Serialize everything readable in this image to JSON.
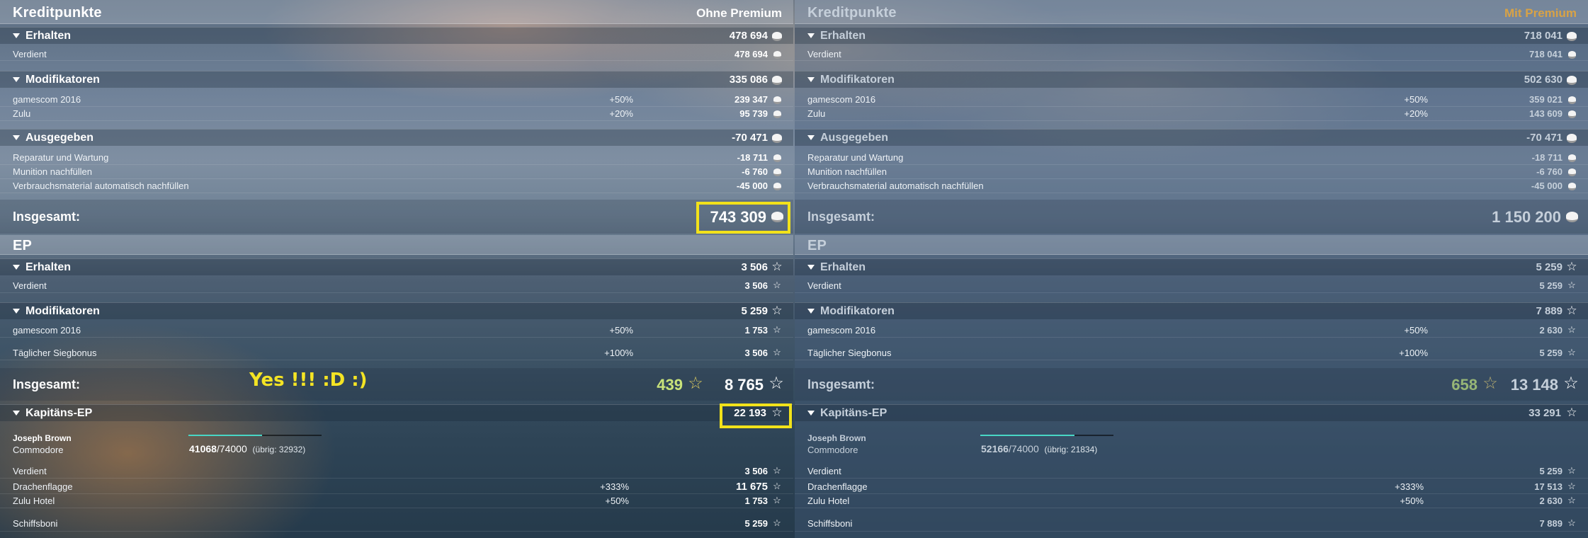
{
  "left": {
    "title": "Kreditpunkte",
    "mode": "Ohne Premium",
    "credits": {
      "earned": {
        "label": "Erhalten",
        "value": "478 694",
        "items": [
          {
            "label": "Verdient",
            "value": "478 694"
          }
        ]
      },
      "modifiers": {
        "label": "Modifikatoren",
        "value": "335 086",
        "items": [
          {
            "label": "gamescom 2016",
            "pct": "+50%",
            "value": "239 347"
          },
          {
            "label": "Zulu",
            "pct": "+20%",
            "value": "95 739"
          }
        ]
      },
      "spent": {
        "label": "Ausgegeben",
        "value": "-70 471",
        "items": [
          {
            "label": "Reparatur und Wartung",
            "value": "-18 711"
          },
          {
            "label": "Munition nachfüllen",
            "value": "-6 760"
          },
          {
            "label": "Verbrauchsmaterial automatisch nachfüllen",
            "value": "-45 000"
          }
        ]
      },
      "total_label": "Insgesamt:",
      "total": "743 309"
    },
    "ep": {
      "title": "EP",
      "earned": {
        "label": "Erhalten",
        "value": "3 506",
        "items": [
          {
            "label": "Verdient",
            "value": "3 506"
          }
        ]
      },
      "modifiers": {
        "label": "Modifikatoren",
        "value": "5 259",
        "items": [
          {
            "label": "gamescom 2016",
            "pct": "+50%",
            "value": "1 753"
          },
          {
            "label": "Täglicher Siegbonus",
            "pct": "+100%",
            "value": "3 506"
          }
        ]
      },
      "total_label": "Insgesamt:",
      "free": "439",
      "total": "8 765"
    },
    "captain": {
      "label": "Kapitäns-EP",
      "value": "22 193",
      "name": "Joseph Brown",
      "rank": "Commodore",
      "xp_current": "41068",
      "xp_max": "/74000",
      "xp_rest": "(übrig: 32932)",
      "progress": 0.555,
      "items": [
        {
          "label": "Verdient",
          "pct": "",
          "value": "3 506"
        },
        {
          "label": "Drachenflagge",
          "pct": "+333%",
          "value": "11 675"
        },
        {
          "label": "Zulu Hotel",
          "pct": "+50%",
          "value": "1 753"
        },
        {
          "label": "Schiffsboni",
          "pct": "",
          "value": "5 259"
        }
      ]
    },
    "annotation": "Yes !!! :D :)"
  },
  "right": {
    "title": "Kreditpunkte",
    "mode": "Mit Premium",
    "credits": {
      "earned": {
        "label": "Erhalten",
        "value": "718 041",
        "items": [
          {
            "label": "Verdient",
            "value": "718 041"
          }
        ]
      },
      "modifiers": {
        "label": "Modifikatoren",
        "value": "502 630",
        "items": [
          {
            "label": "gamescom 2016",
            "pct": "+50%",
            "value": "359 021"
          },
          {
            "label": "Zulu",
            "pct": "+20%",
            "value": "143 609"
          }
        ]
      },
      "spent": {
        "label": "Ausgegeben",
        "value": "-70 471",
        "items": [
          {
            "label": "Reparatur und Wartung",
            "value": "-18 711"
          },
          {
            "label": "Munition nachfüllen",
            "value": "-6 760"
          },
          {
            "label": "Verbrauchsmaterial automatisch nachfüllen",
            "value": "-45 000"
          }
        ]
      },
      "total_label": "Insgesamt:",
      "total": "1 150 200"
    },
    "ep": {
      "title": "EP",
      "earned": {
        "label": "Erhalten",
        "value": "5 259",
        "items": [
          {
            "label": "Verdient",
            "value": "5 259"
          }
        ]
      },
      "modifiers": {
        "label": "Modifikatoren",
        "value": "7 889",
        "items": [
          {
            "label": "gamescom 2016",
            "pct": "+50%",
            "value": "2 630"
          },
          {
            "label": "Täglicher Siegbonus",
            "pct": "+100%",
            "value": "5 259"
          }
        ]
      },
      "total_label": "Insgesamt:",
      "free": "658",
      "total": "13 148"
    },
    "captain": {
      "label": "Kapitäns-EP",
      "value": "33 291",
      "name": "Joseph Brown",
      "rank": "Commodore",
      "xp_current": "52166",
      "xp_max": "/74000",
      "xp_rest": "(übrig: 21834)",
      "progress": 0.705,
      "items": [
        {
          "label": "Verdient",
          "pct": "",
          "value": "5 259"
        },
        {
          "label": "Drachenflagge",
          "pct": "+333%",
          "value": "17 513"
        },
        {
          "label": "Zulu Hotel",
          "pct": "+50%",
          "value": "2 630"
        },
        {
          "label": "Schiffsboni",
          "pct": "",
          "value": "7 889"
        }
      ]
    }
  },
  "colors": {
    "highlight": "#f2e21a",
    "annotation": "#f4e424",
    "premium": "#d8a246",
    "progress": "#48d6c5",
    "free_xp": "#c9e37a"
  },
  "icons": {
    "credits": "silver-coin-icon",
    "xp": "star-icon",
    "section": "caret-down-icon"
  }
}
